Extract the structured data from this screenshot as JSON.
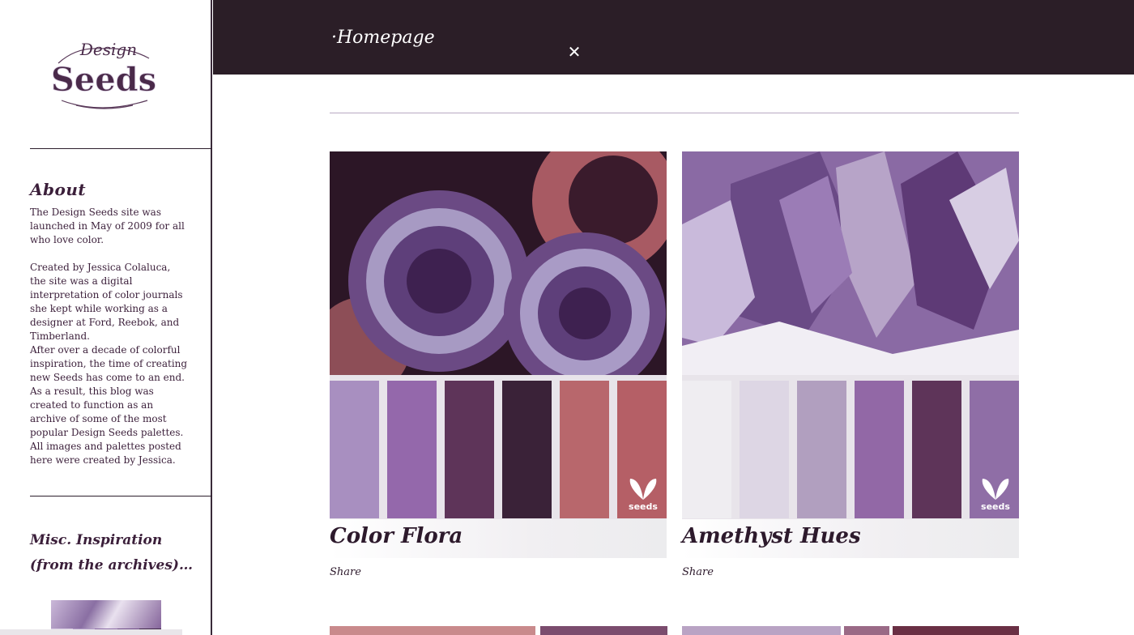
{
  "sidebar": {
    "logo_text_top": "Design",
    "logo_text_main": "Seeds",
    "about": {
      "heading": "About",
      "paragraphs": [
        "The Design Seeds site was launched in May of 2009 for all who love color.",
        "Created by Jessica Colaluca, the site was a digital interpretation of color journals she kept while working as a designer at Ford, Reebok, and Timberland.",
        "After over a decade of colorful inspiration, the time of creating new Seeds has come to an end. As a result, this blog was created to function as an archive of some of the most popular Design Seeds palettes. All images and palettes posted here were created by Jessica."
      ]
    },
    "misc": {
      "heading_line1": "Misc. Inspiration",
      "heading_line2": "(from the archives)…"
    }
  },
  "header": {
    "nav_home": "·Homepage",
    "close_icon": "close-icon"
  },
  "cards": [
    {
      "title": "Color Flora",
      "share_label": "Share",
      "seeds_badge": "seeds",
      "colors": [
        "#a88fc0",
        "#9468ab",
        "#5e3459",
        "#3a2238",
        "#b8676c",
        "#b55f66"
      ]
    },
    {
      "title": "Amethyst Hues",
      "share_label": "Share",
      "seeds_badge": "seeds",
      "colors": [
        "#efedf1",
        "#ddd6e4",
        "#b19fbf",
        "#9268a6",
        "#5e3459",
        "#8f6ea6"
      ]
    }
  ]
}
